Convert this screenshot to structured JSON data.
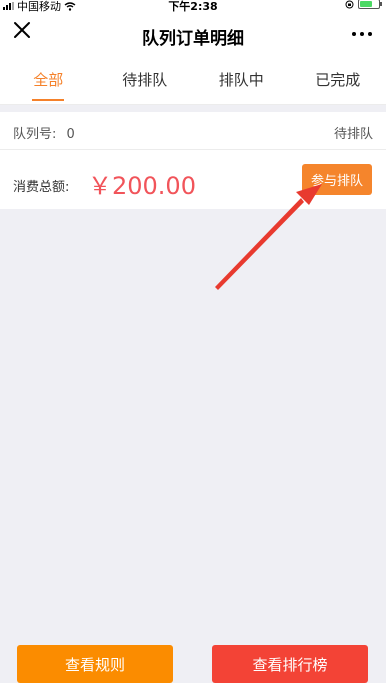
{
  "status_bar": {
    "carrier": "中国移动",
    "time": "下午2:38"
  },
  "nav": {
    "title": "队列订单明细"
  },
  "tabs": [
    {
      "label": "全部",
      "active": true
    },
    {
      "label": "待排队",
      "active": false
    },
    {
      "label": "排队中",
      "active": false
    },
    {
      "label": "已完成",
      "active": false
    }
  ],
  "order": {
    "queue_label": "队列号:",
    "queue_number": "0",
    "status": "待排队",
    "total_label": "消费总额:",
    "total_amount": "￥200.00",
    "join_label": "参与排队"
  },
  "footer": {
    "rules_label": "查看规则",
    "ranking_label": "查看排行榜"
  },
  "colors": {
    "accent": "#f5812a",
    "amount": "#f1545a",
    "rules_button": "#fb8c00",
    "ranking_button": "#f34336",
    "annotation_arrow": "#e83a2f"
  }
}
